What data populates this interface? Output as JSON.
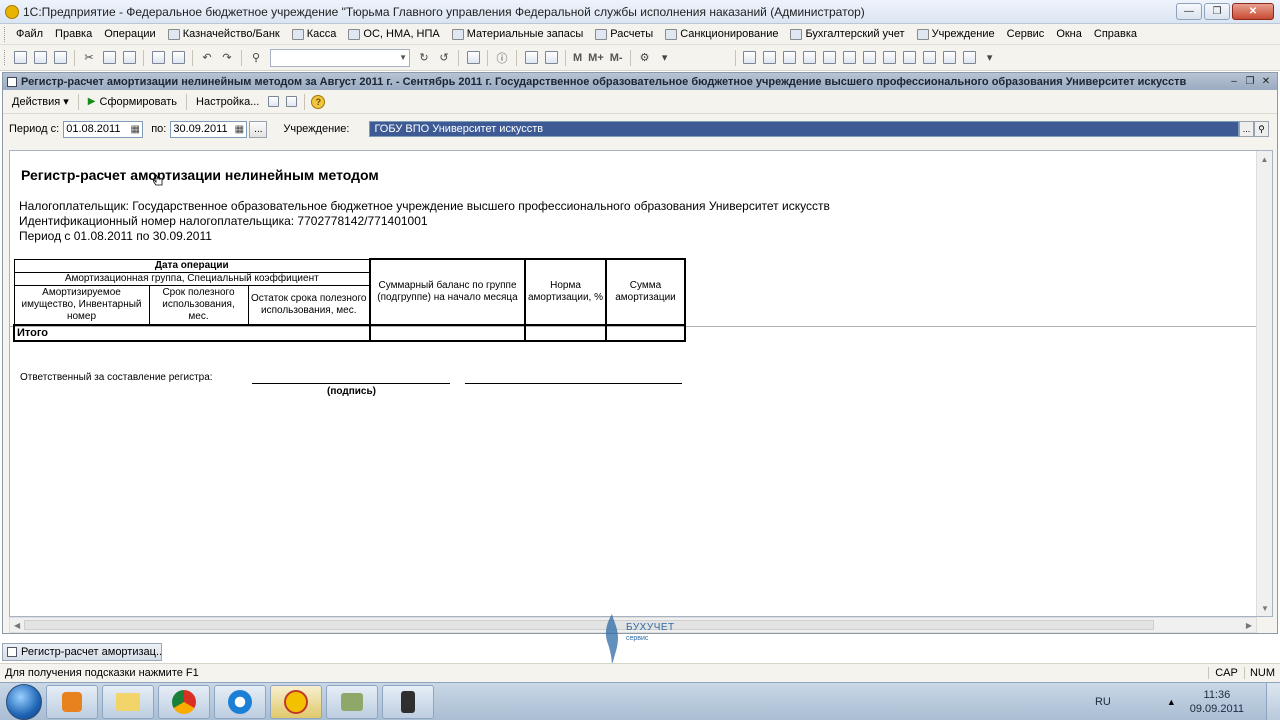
{
  "window": {
    "title": "1С:Предприятие - Федеральное бюджетное учреждение \"Тюрьма Главного управления Федеральной службы исполнения наказаний (Администратор)"
  },
  "menu": [
    {
      "label": "Файл",
      "icon": "none"
    },
    {
      "label": "Правка",
      "icon": "none"
    },
    {
      "label": "Операции",
      "icon": "none"
    },
    {
      "label": "Казначейство/Банк",
      "icon": "bank-icon"
    },
    {
      "label": "Касса",
      "icon": "cash-icon"
    },
    {
      "label": "ОС, НМА, НПА",
      "icon": "assets-icon"
    },
    {
      "label": "Материальные запасы",
      "icon": "materials-icon"
    },
    {
      "label": "Расчеты",
      "icon": "calculations-icon"
    },
    {
      "label": "Санкционирование",
      "icon": "sanction-icon"
    },
    {
      "label": "Бухгалтерский учет",
      "icon": "accounting-icon"
    },
    {
      "label": "Учреждение",
      "icon": "institution-icon"
    },
    {
      "label": "Сервис",
      "icon": "none"
    },
    {
      "label": "Окна",
      "icon": "none"
    },
    {
      "label": "Справка",
      "icon": "none"
    }
  ],
  "toolbar": {
    "memory_buttons": [
      "M",
      "M+",
      "M-"
    ]
  },
  "document": {
    "header_title": "Регистр-расчет амортизации нелинейным методом за Август 2011 г. - Сентябрь 2011 г. Государственное образовательное бюджетное учреждение высшего профессионального образования  Университет искусств",
    "actions": {
      "actions_label": "Действия",
      "generate_label": "Сформировать",
      "settings_label": "Настройка..."
    },
    "params": {
      "period_from_label": "Период с:",
      "period_from": "01.08.2011",
      "period_to_label": "по:",
      "period_to": "30.09.2011",
      "dots_label": "...",
      "org_label": "Учреждение:",
      "org_value": "ГОБУ ВПО Университет искусств"
    }
  },
  "report": {
    "title": "Регистр-расчет амортизации нелинейным методом",
    "taxpayer": "Налогоплательщик: Государственное образовательное бюджетное учреждение высшего профессионального образования  Университет искусств",
    "inn": "Идентификационный номер налогоплательщика: 7702778142/771401001",
    "period": "Период с 01.08.2011 по 30.09.2011",
    "table": {
      "h_date": "Дата операции",
      "h_group": "Амортизационная группа, Специальный коэффициент",
      "h_property": "Амортизируемое имущество, Инвентарный номер",
      "h_useful_life": "Срок полезного использования, мес.",
      "h_remaining": "Остаток срока полезного использования, мес.",
      "h_balance": "Суммарный баланс по группе (подгруппе) на начало месяца",
      "h_norm": "Норма амортизации, %",
      "h_sum": "Сумма амортизации",
      "total_label": "Итого"
    },
    "responsible_label": "Ответственный за составление регистра:",
    "signature_caption": "(подпись)"
  },
  "taskwindow": {
    "label": "Регистр-расчет амортизац..."
  },
  "logo": {
    "name": "БУХУЧЕТ",
    "sub": "сервис"
  },
  "status": {
    "hint": "Для получения подсказки нажмите F1",
    "cap": "CAP",
    "num": "NUM"
  },
  "taskbar": {
    "lang": "RU",
    "time": "11:36",
    "date": "09.09.2011"
  }
}
